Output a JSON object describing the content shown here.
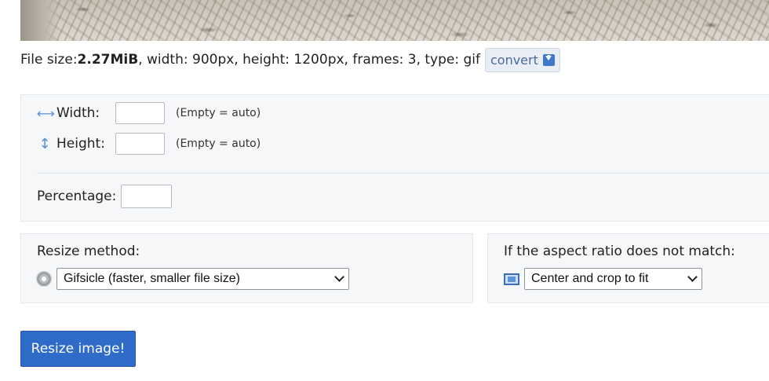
{
  "file_info": {
    "size_label": "File size: ",
    "size_value": "2.27MiB",
    "details": ", width: 900px, height: 1200px, frames: 3, type: gif",
    "convert_label": "convert"
  },
  "dimensions": {
    "width_label": "Width:",
    "width_value": "",
    "width_hint": "(Empty = auto)",
    "height_label": "Height:",
    "height_value": "",
    "height_hint": "(Empty = auto)",
    "percentage_label": "Percentage:",
    "percentage_value": ""
  },
  "resize_method": {
    "title": "Resize method:",
    "selected": "Gifsicle (faster, smaller file size)",
    "icon": "gear-icon"
  },
  "aspect_ratio": {
    "title": "If the aspect ratio does not match:",
    "selected": "Center and crop to fit",
    "icon": "frame-icon"
  },
  "actions": {
    "resize_label": "Resize image!"
  },
  "colors": {
    "accent": "#2f6bc9",
    "panel_bg": "#f6f7f9",
    "convert_bg": "#e9eef6"
  }
}
